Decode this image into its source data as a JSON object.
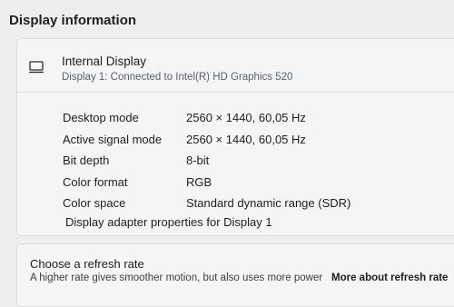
{
  "section": {
    "title": "Display information"
  },
  "display_card": {
    "icon": "monitor-icon",
    "name": "Internal Display",
    "subtitle": "Display 1: Connected to Intel(R) HD Graphics 520",
    "rows": [
      {
        "label": "Desktop mode",
        "value": "2560 × 1440, 60,05 Hz"
      },
      {
        "label": "Active signal mode",
        "value": "2560 × 1440, 60,05 Hz"
      },
      {
        "label": "Bit depth",
        "value": "8-bit"
      },
      {
        "label": "Color format",
        "value": "RGB"
      },
      {
        "label": "Color space",
        "value": "Standard dynamic range (SDR)"
      }
    ],
    "adapter_link": "Display adapter properties for Display 1"
  },
  "refresh_card": {
    "title": "Choose a refresh rate",
    "description": "A higher rate gives smoother motion, but also uses more power",
    "link": "More about refresh rate"
  }
}
